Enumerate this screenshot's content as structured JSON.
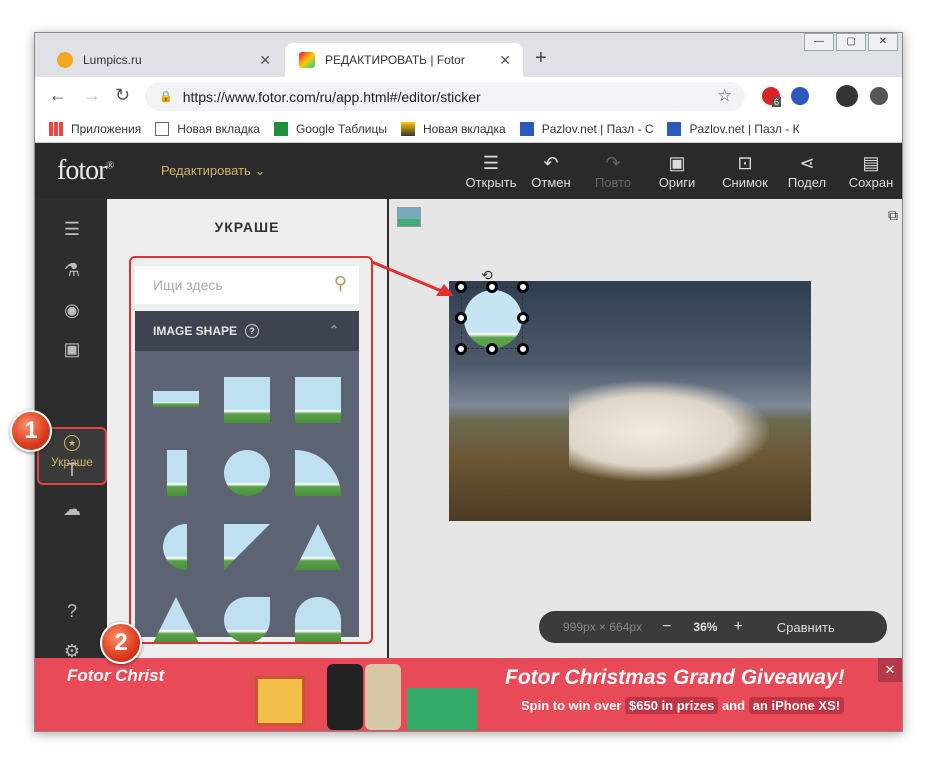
{
  "browser": {
    "tabs": [
      {
        "label": "Lumpics.ru",
        "active": false
      },
      {
        "label": "РЕДАКТИРОВАТЬ | Fotor",
        "active": true
      }
    ],
    "url": "https://www.fotor.com/ru/app.html#/editor/sticker",
    "ext_badge": "6",
    "bookmarks": [
      "Приложения",
      "Новая вкладка",
      "Google Таблицы",
      "Новая вкладка",
      "Pazlov.net | Пазл - С",
      "Pazlov.net | Пазл - К"
    ]
  },
  "app": {
    "logo": "fotor",
    "logo_mark": "®",
    "edit_menu": "Редактировать",
    "toolbar": [
      "Открыть",
      "Отмен",
      "Повто",
      "Ориги",
      "Снимок",
      "Подел",
      "Сохран"
    ],
    "left_selected": "Украше"
  },
  "panel": {
    "title": "УКРАШЕ",
    "search_placeholder": "Ищи здесь",
    "section": "IMAGE SHAPE"
  },
  "zoom": {
    "size": "999px × 664px",
    "minus": "−",
    "level": "36%",
    "plus": "+",
    "compare": "Сравнить"
  },
  "ad": {
    "left": "Fotor Christ",
    "title": "Fotor Christmas Grand Giveaway!",
    "sub_1": "Spin to win over",
    "amount": "$650 in prizes",
    "sub_2": "and",
    "prize": "an iPhone XS!"
  },
  "annotations": {
    "step1": "1",
    "step2": "2"
  },
  "colors": {
    "accent": "#d3b36b",
    "annotation": "#e03030",
    "ad_bg": "#e84b57"
  }
}
